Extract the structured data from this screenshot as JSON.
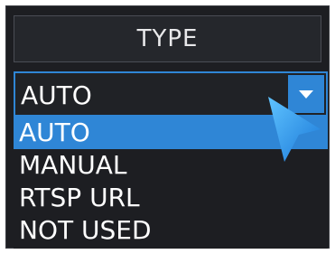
{
  "header": {
    "title": "TYPE"
  },
  "select": {
    "value": "AUTO",
    "arrow_icon": "chevron-down-icon",
    "options": [
      {
        "label": "AUTO",
        "selected": true
      },
      {
        "label": "MANUAL",
        "selected": false
      },
      {
        "label": "RTSP URL",
        "selected": false
      },
      {
        "label": "NOT USED",
        "selected": false
      }
    ]
  },
  "colors": {
    "panel_bg": "#1d1e22",
    "accent": "#2f86d6",
    "text": "#ffffff"
  },
  "pointer": {
    "icon": "mouse-pointer-icon"
  }
}
